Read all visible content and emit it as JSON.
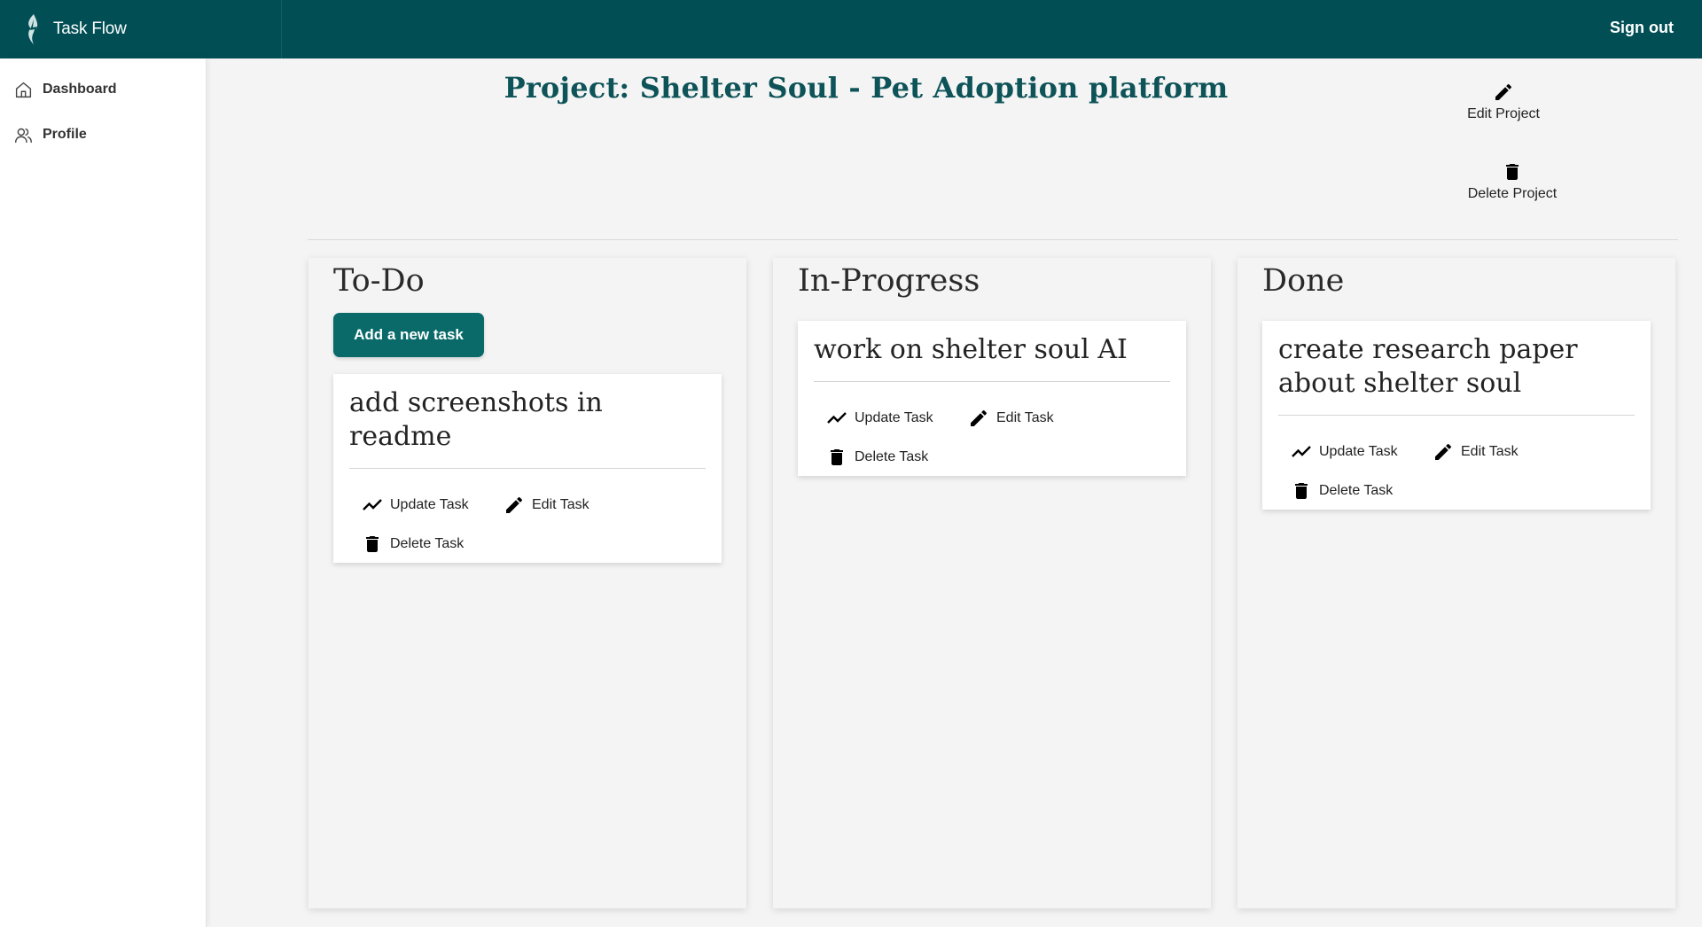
{
  "header": {
    "app_title": "Task Flow",
    "sign_out_label": "Sign out",
    "background_color": "#014f55"
  },
  "sidebar": {
    "items": [
      {
        "label": "Dashboard",
        "icon": "home-icon"
      },
      {
        "label": "Profile",
        "icon": "users-icon"
      }
    ]
  },
  "project": {
    "title": "Project: Shelter Soul - Pet Adoption platform",
    "edit_label": "Edit Project",
    "delete_label": "Delete Project"
  },
  "board": {
    "add_task_label": "Add a new task",
    "accent_color": "#0a6a6a",
    "columns": [
      {
        "title": "To-Do",
        "tasks": [
          {
            "title": "add screenshots in readme"
          }
        ]
      },
      {
        "title": "In-Progress",
        "tasks": [
          {
            "title": "work on shelter soul AI"
          }
        ]
      },
      {
        "title": "Done",
        "tasks": [
          {
            "title": "create research paper about shelter soul"
          }
        ]
      }
    ],
    "task_actions": {
      "update_label": "Update Task",
      "edit_label": "Edit Task",
      "delete_label": "Delete Task"
    }
  }
}
